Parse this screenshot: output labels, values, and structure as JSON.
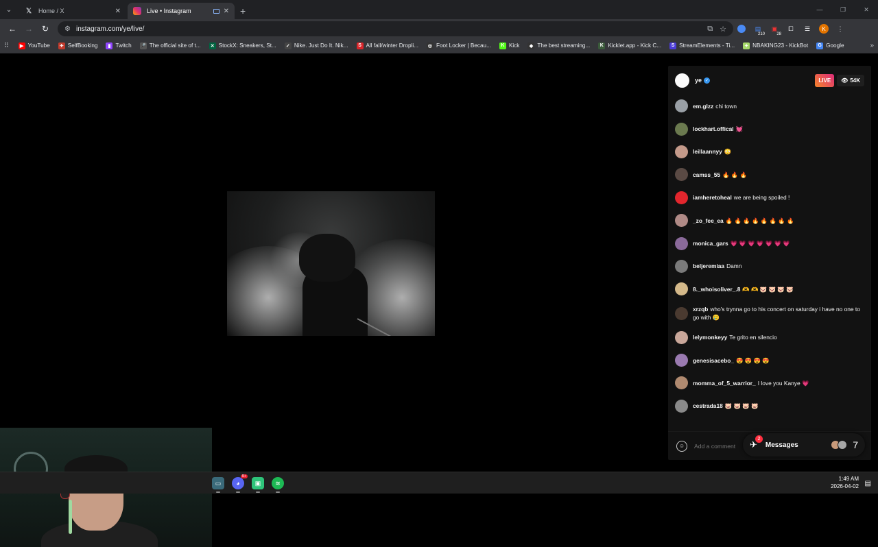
{
  "browser": {
    "tabs": [
      {
        "title": "Home / X",
        "favicon": "x-icon",
        "active": false
      },
      {
        "title": "Live • Instagram",
        "favicon": "instagram-icon",
        "active": true
      }
    ],
    "new_tab_label": "+",
    "url": "instagram.com/ye/live/",
    "extension_counts": {
      "ext2": "210",
      "ext3": "28"
    },
    "profile_initial": "K"
  },
  "bookmarks": [
    {
      "label": "YouTube",
      "color": "#ff0000",
      "glyph": "▶"
    },
    {
      "label": "SelfBooking",
      "color": "#c0392b",
      "glyph": "✈"
    },
    {
      "label": "Twitch",
      "color": "#9146ff",
      "glyph": "▮"
    },
    {
      "label": "The official site of t...",
      "color": "#555",
      "glyph": "🎤"
    },
    {
      "label": "StockX: Sneakers, St...",
      "color": "#006340",
      "glyph": "✕"
    },
    {
      "label": "Nike. Just Do It. Nik...",
      "color": "#444",
      "glyph": "✓"
    },
    {
      "label": "All fall/winter Dropli...",
      "color": "#d9252a",
      "glyph": "S"
    },
    {
      "label": "Foot Locker | Becau...",
      "color": "#333",
      "glyph": "◎"
    },
    {
      "label": "Kick",
      "color": "#53fc18",
      "glyph": "K"
    },
    {
      "label": "The best streaming...",
      "color": "#333",
      "glyph": "◆"
    },
    {
      "label": "Kicklet.app - Kick C...",
      "color": "#3a5a3a",
      "glyph": "K"
    },
    {
      "label": "StreamElements - Ti...",
      "color": "#4b3cd8",
      "glyph": "S"
    },
    {
      "label": "NBAKING23 - KickBot",
      "color": "#a6d96a",
      "glyph": "✦"
    },
    {
      "label": "Google",
      "color": "#4285f4",
      "glyph": "G"
    }
  ],
  "live": {
    "host": "ye",
    "live_badge": "LIVE",
    "viewers": "54K",
    "comment_placeholder": "Add a comment",
    "comments": [
      {
        "user": "em.glzz",
        "text": "chi town",
        "avatar": "#9aa0a6"
      },
      {
        "user": "lockhart.offical",
        "text": "💓",
        "avatar": "#6b7a4f"
      },
      {
        "user": "leillaannyy",
        "text": "😳",
        "avatar": "#c49a8a"
      },
      {
        "user": "camss_55",
        "text": "🔥 🔥 🔥",
        "avatar": "#5a4a44"
      },
      {
        "user": "iamheretoheal",
        "text": "we are being spoiled !",
        "avatar": "#e3262d"
      },
      {
        "user": "_zo_fee_ea",
        "text": "🔥 🔥 🔥 🔥 🔥 🔥 🔥 🔥",
        "avatar": "#b08a86"
      },
      {
        "user": "monica_gars",
        "text": "💗 💗 💗 💗 💗 💗 💗",
        "avatar": "#8a6a9a"
      },
      {
        "user": "beljeremiaa",
        "text": "Damn",
        "avatar": "#7a7a7a"
      },
      {
        "user": "8._whoisoliver_.8",
        "text": "🫶 🫶 🐷 🐷 🐷 🐷",
        "avatar": "#d4b98a"
      },
      {
        "user": "xrzqb",
        "text": "who's trynna go to his concert on saturday i have no one to go with 🥲",
        "avatar": "#4a3a30"
      },
      {
        "user": "lelymonkeyy",
        "text": "Te grito en silencio",
        "avatar": "#c9a79a"
      },
      {
        "user": "genesisacebo_",
        "text": "😍 😍 😍 😍",
        "avatar": "#9a7ab0"
      },
      {
        "user": "momma_of_5_warrior_",
        "text": "I love you Kanye 💗",
        "avatar": "#b08a70"
      },
      {
        "user": "cestrada18",
        "text": "🐷 🐷 🐷 🐷",
        "avatar": "#8a8a8a"
      }
    ]
  },
  "messages": {
    "label": "Messages",
    "badge": "2",
    "count_glyph": "7"
  },
  "taskbar": {
    "time": "1:49 AM",
    "date": "2026-04-02",
    "discord_badge": "9+"
  }
}
